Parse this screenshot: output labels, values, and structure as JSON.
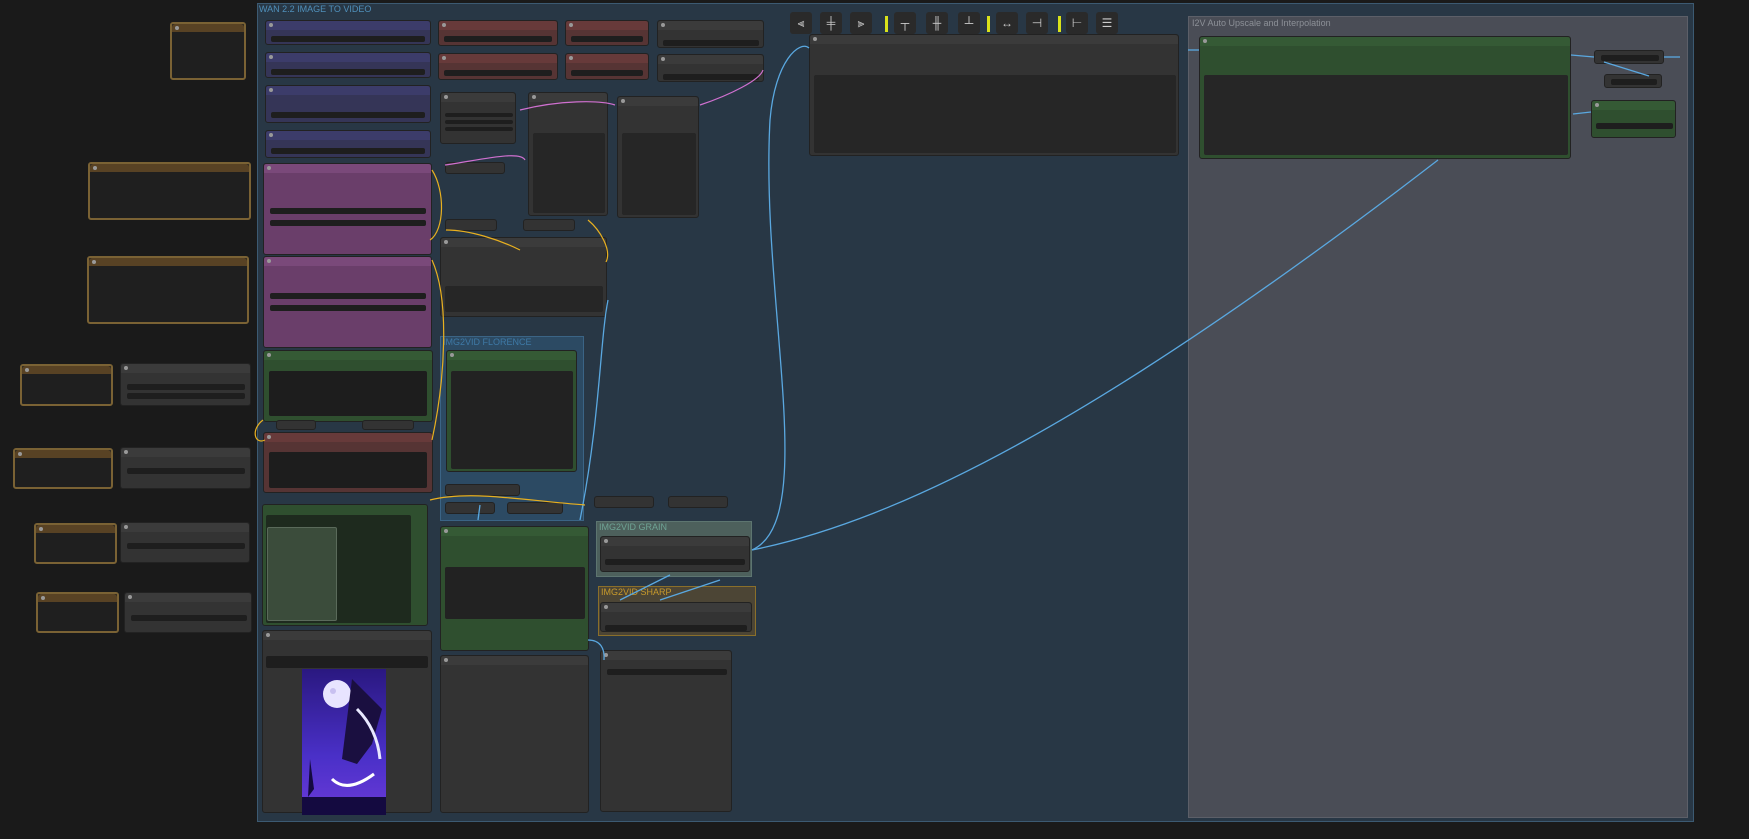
{
  "groups": {
    "main_title": "WAN 2.2 IMAGE TO VIDEO",
    "upscale_title": "I2V Auto Upscale and Interpolation",
    "florence_title": "IMG2VID FLORENCE",
    "grain_title": "IMG2VID GRAIN",
    "sharp_title": "IMG2VID SHARP"
  },
  "colors": {
    "canvas": "#1a1a1a",
    "group_main": "#283745",
    "group_upscale": "#4a4d56",
    "wire_blue": "#5aa8e0",
    "wire_yellow": "#e8b020",
    "wire_pink": "#d070d0",
    "accent_yellow": "#d9e21a"
  },
  "toolbar": {
    "icons": [
      "align-left-icon",
      "align-center-h-icon",
      "align-right-icon",
      "align-top-icon",
      "align-center-v-icon",
      "align-bottom-icon",
      "distribute-h-icon",
      "distribute-left-icon",
      "distribute-right-icon",
      "distribute-v-icon"
    ]
  }
}
